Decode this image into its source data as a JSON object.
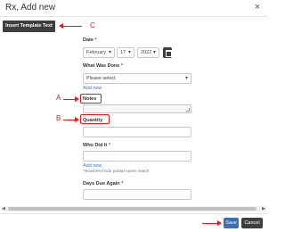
{
  "dialog": {
    "title": "Rx, Add new",
    "close_glyph": "×"
  },
  "toolbar": {
    "insert_template_label": "Insert Template Text"
  },
  "callouts": {
    "a": "A",
    "b": "B",
    "c": "C",
    "color": "#e21c1c"
  },
  "form": {
    "date": {
      "label": "Date",
      "required": "*",
      "month": "February",
      "day": "17",
      "year": "2022"
    },
    "what_was_done": {
      "label": "What Was Done",
      "required": "*",
      "selected": "Please select",
      "add_new": "Add new"
    },
    "notes": {
      "label": "Notes"
    },
    "quantity": {
      "label": "Quantity"
    },
    "who_did_it": {
      "label": "Who Did It",
      "required": "*",
      "add_new": "Add new",
      "hint": "?enameN finds partial name match"
    },
    "days_due_again": {
      "label": "Days Due Again",
      "required": "*"
    }
  },
  "footer": {
    "save_label": "Save",
    "cancel_label": "Cancel"
  },
  "colors": {
    "save": "#3a6fb0",
    "dark_button": "#3e3e3e",
    "link": "#3a7bc8"
  },
  "icons": {
    "calendar": "calendar-icon",
    "close": "close-icon"
  }
}
